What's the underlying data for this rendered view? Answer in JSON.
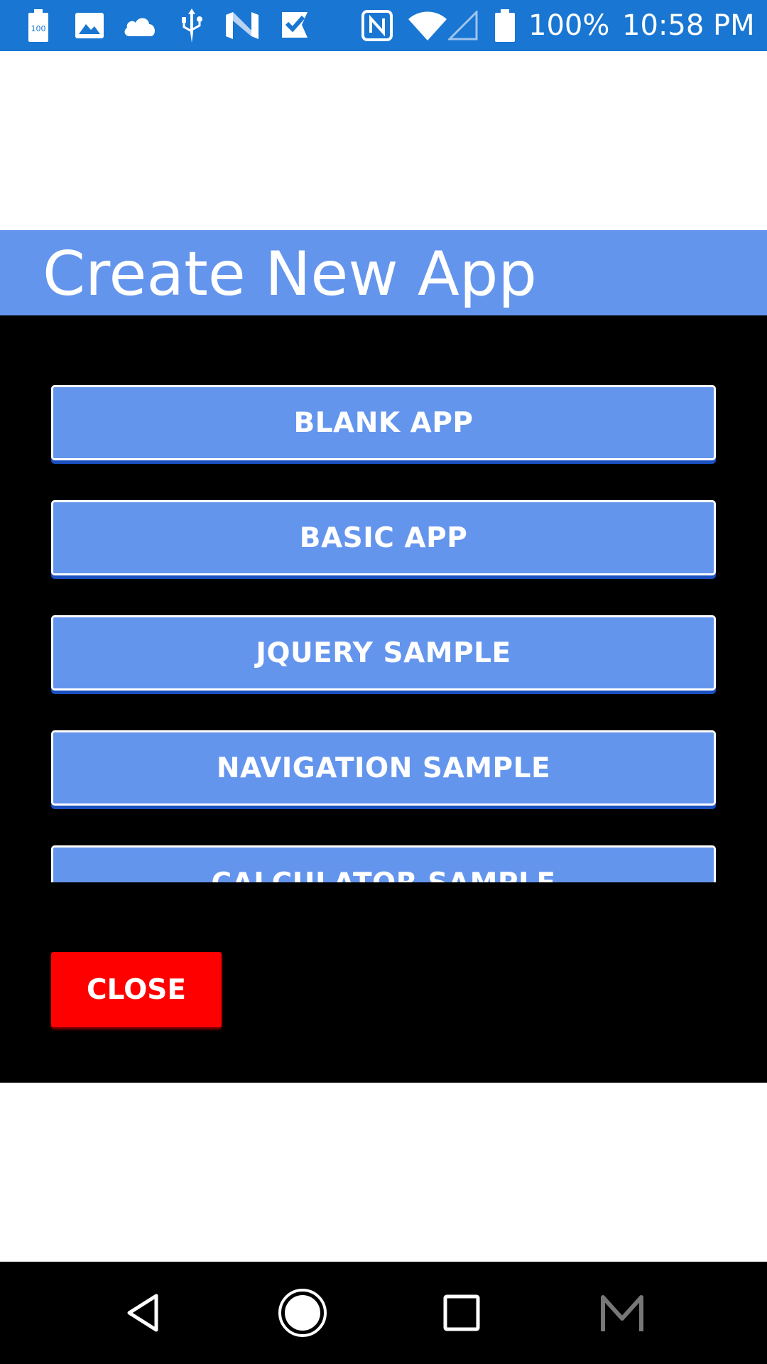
{
  "status_bar": {
    "battery_small_label": "100",
    "battery_percent": "100%",
    "time": "10:58 PM",
    "background_color": "#1976d2",
    "left_icons": [
      "battery-saver-icon",
      "image-icon",
      "cloud-icon",
      "usb-icon",
      "n-logo-icon",
      "check-flag-icon"
    ],
    "right_icons": [
      "nfc-icon",
      "wifi-icon",
      "cellular-signal-icon",
      "battery-icon"
    ]
  },
  "dialog": {
    "title": "Create New App",
    "title_bar_color": "#6495ed",
    "body_color": "#000000",
    "templates": [
      {
        "label": "BLANK APP"
      },
      {
        "label": "BASIC APP"
      },
      {
        "label": "JQUERY SAMPLE"
      },
      {
        "label": "NAVIGATION SAMPLE"
      },
      {
        "label": "CALCULATOR SAMPLE"
      }
    ],
    "close_label": "CLOSE",
    "close_color": "#ff0000"
  },
  "nav_bar": {
    "buttons": [
      "back-icon",
      "home-icon",
      "recents-icon",
      "m-icon"
    ]
  }
}
